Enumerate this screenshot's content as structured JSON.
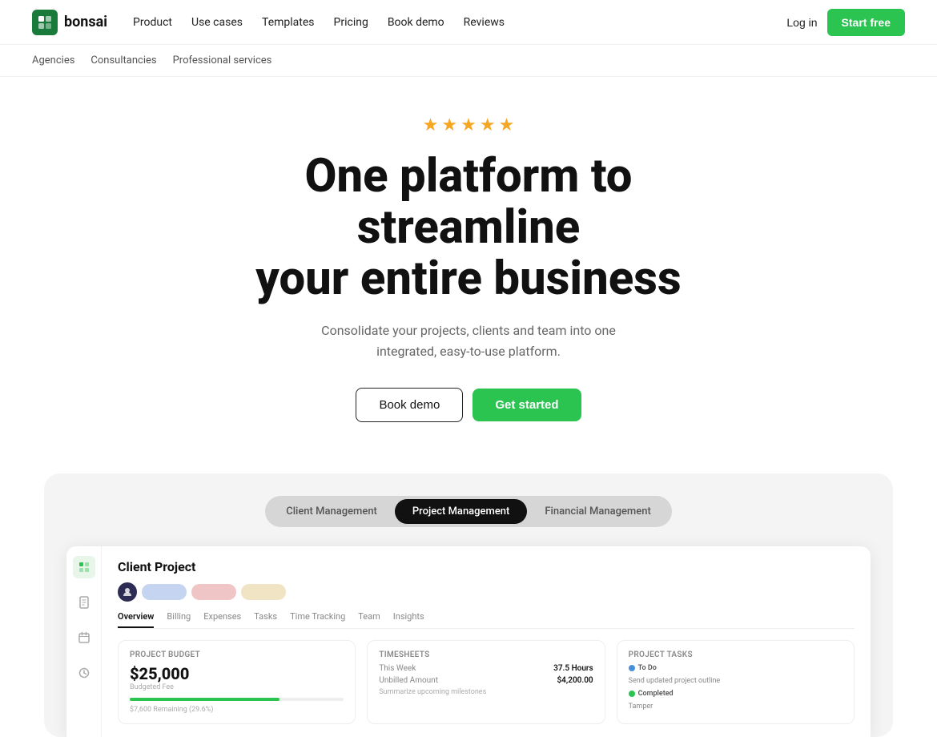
{
  "navbar": {
    "logo_text": "bonsai",
    "links": [
      {
        "label": "Product",
        "id": "product"
      },
      {
        "label": "Use cases",
        "id": "use-cases"
      },
      {
        "label": "Templates",
        "id": "templates"
      },
      {
        "label": "Pricing",
        "id": "pricing"
      },
      {
        "label": "Book demo",
        "id": "book-demo"
      },
      {
        "label": "Reviews",
        "id": "reviews"
      }
    ],
    "login_label": "Log in",
    "start_label": "Start free"
  },
  "submenu": {
    "items": [
      {
        "label": "Agencies"
      },
      {
        "label": "Consultancies"
      },
      {
        "label": "Professional services"
      }
    ]
  },
  "hero": {
    "stars_count": 5,
    "title_line1": "One platform to streamline",
    "title_line2": "your entire business",
    "subtitle": "Consolidate your projects, clients and team into one integrated, easy-to-use platform.",
    "btn_demo": "Book demo",
    "btn_start": "Get started"
  },
  "demo": {
    "tabs": [
      {
        "label": "Client Management",
        "active": false
      },
      {
        "label": "Project Management",
        "active": true
      },
      {
        "label": "Financial Management",
        "active": false
      }
    ],
    "app": {
      "project_title": "Client Project",
      "nav_tabs": [
        {
          "label": "Overview",
          "active": true
        },
        {
          "label": "Billing",
          "active": false
        },
        {
          "label": "Expenses",
          "active": false
        },
        {
          "label": "Tasks",
          "active": false
        },
        {
          "label": "Time Tracking",
          "active": false
        },
        {
          "label": "Team",
          "active": false
        },
        {
          "label": "Insights",
          "active": false
        }
      ],
      "budget_card": {
        "title": "Project Budget",
        "amount": "$25,000",
        "label": "Budgeted Fee",
        "bar_percent": 70,
        "remaining": "$7,600 Remaining (29.6%)"
      },
      "timesheets_card": {
        "title": "Timesheets",
        "rows": [
          {
            "label": "This Week",
            "value": "37.5 Hours"
          },
          {
            "label": "Unbilled Amount",
            "value": "$4,200.00"
          }
        ],
        "sub": "Summarize upcoming milestones"
      },
      "tasks_card": {
        "title": "Project Tasks",
        "todo_label": "To Do",
        "completed_label": "Completed",
        "task1": "Send updated project outline",
        "task2": "Tamper"
      }
    }
  },
  "colors": {
    "green": "#2bc451",
    "dark": "#111111",
    "gray_bg": "#f4f4f4"
  }
}
